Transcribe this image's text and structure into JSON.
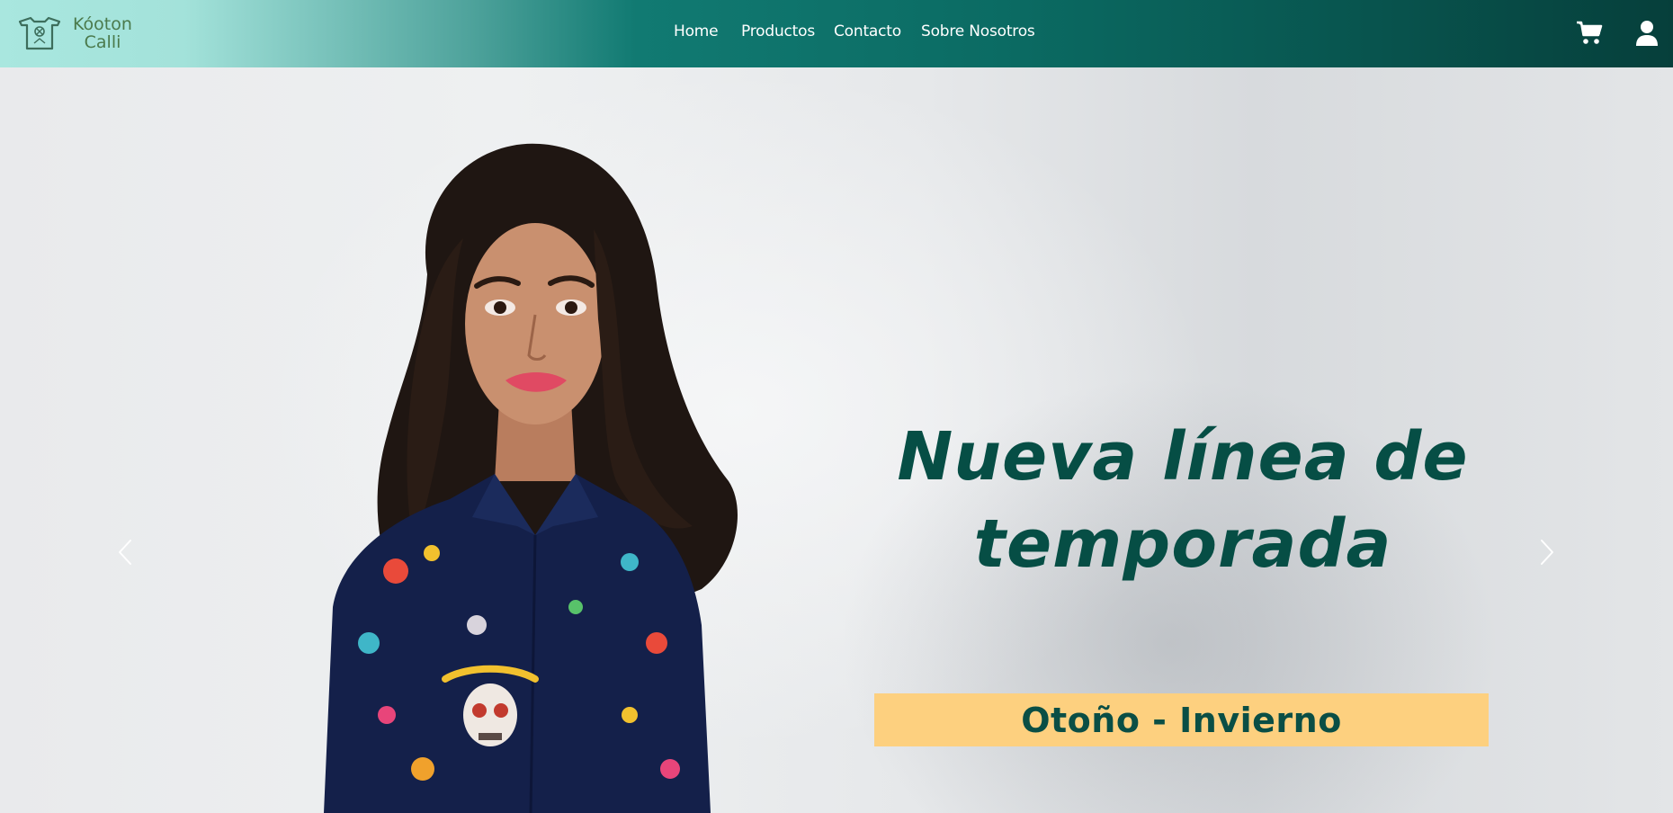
{
  "brand": {
    "name_line1": "Kóoton",
    "name_line2": "Calli",
    "logo_icon": "shirt-logo-icon"
  },
  "nav": {
    "links": [
      {
        "label": "Home"
      },
      {
        "label": "Productos"
      },
      {
        "label": "Contacto"
      },
      {
        "label": "Sobre Nosotros"
      }
    ],
    "cart_icon": "cart-icon",
    "user_icon": "user-icon"
  },
  "hero": {
    "headline_line1": "Nueva línea de",
    "headline_line2": "temporada",
    "season_label": "Otoño - Invierno",
    "prev_icon": "chevron-left-icon",
    "next_icon": "chevron-right-icon"
  },
  "colors": {
    "navbar_start": "#a9e7df",
    "navbar_end": "#063f3b",
    "headline": "#064e45",
    "season_banner": "#fdd07f"
  }
}
